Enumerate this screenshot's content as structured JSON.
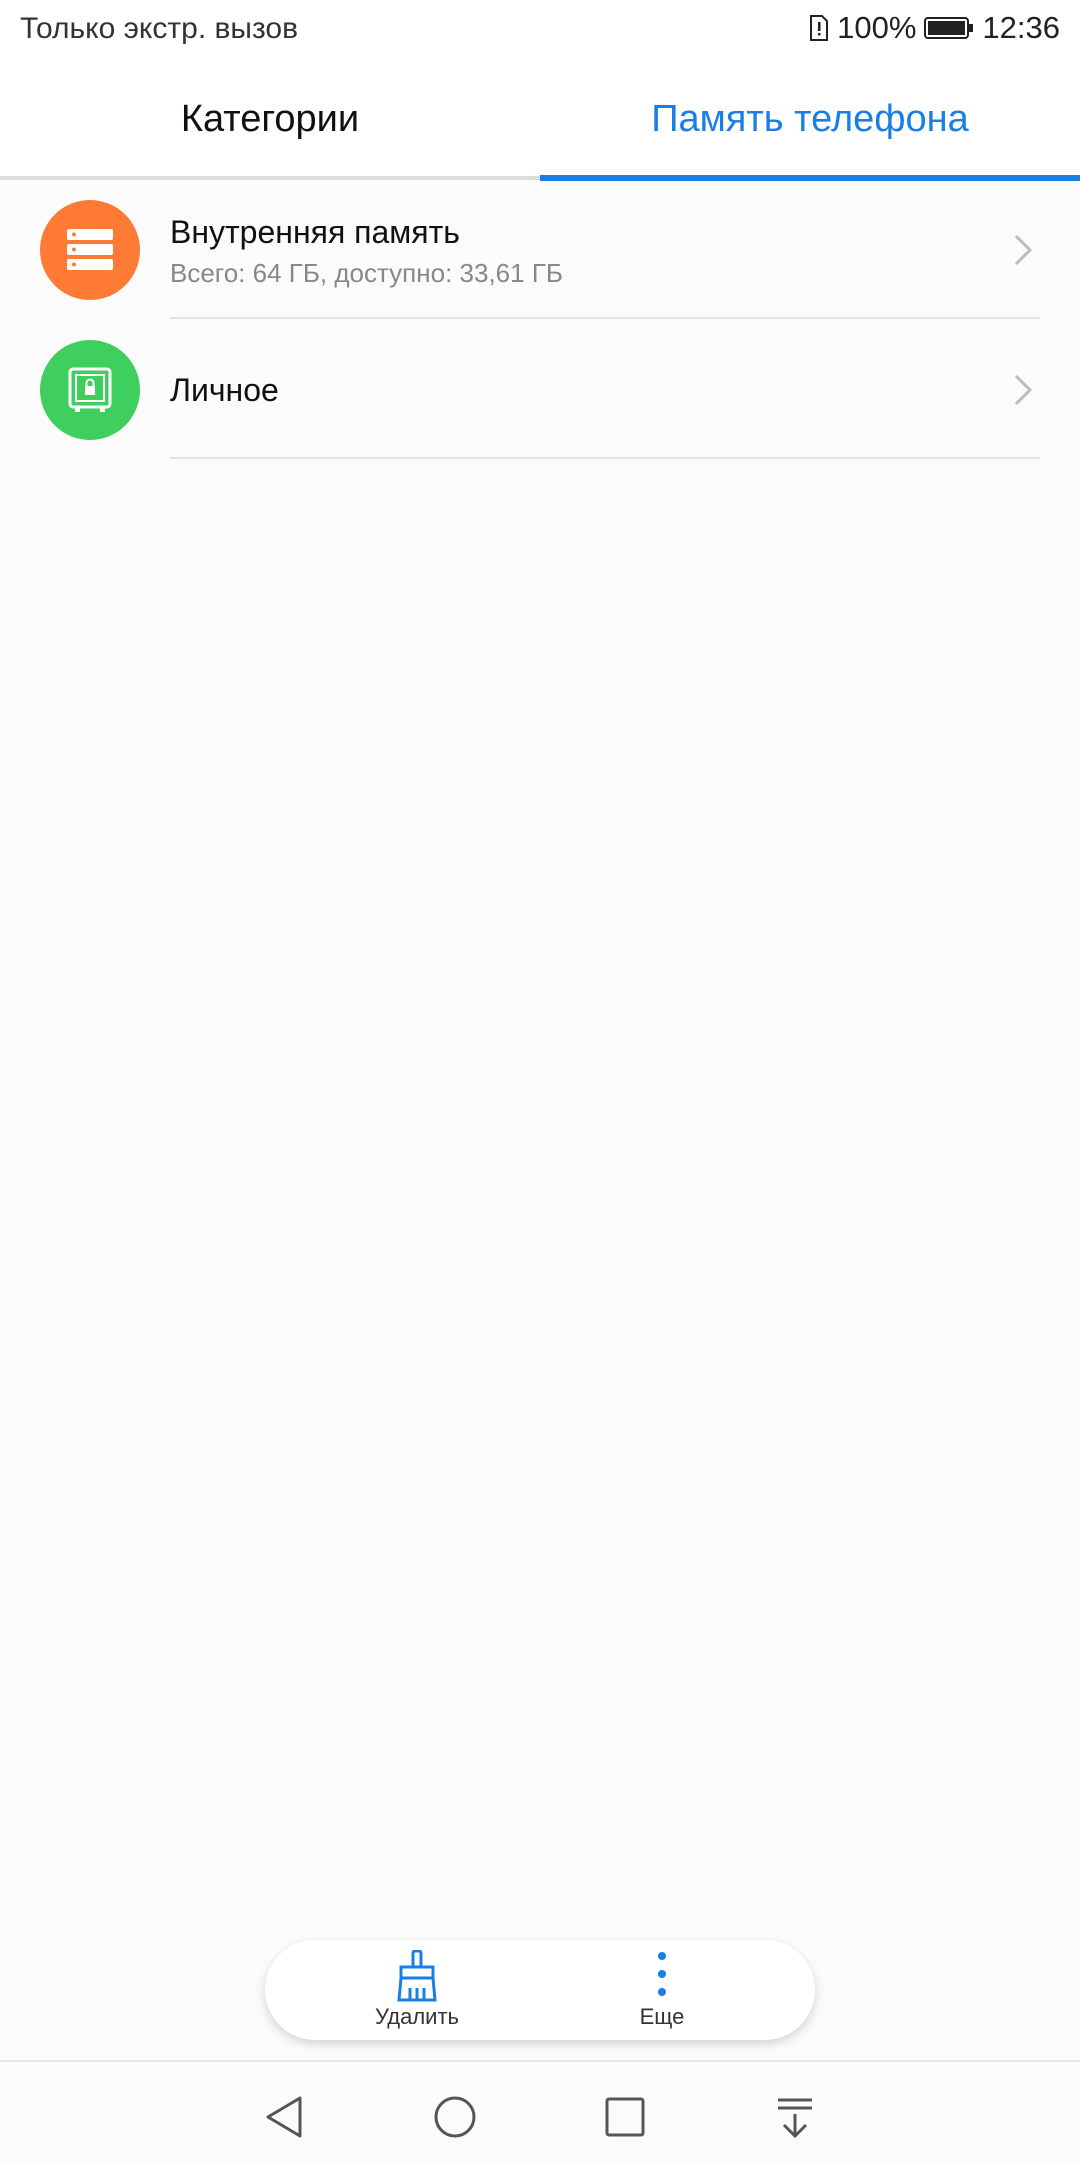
{
  "status_bar": {
    "carrier_text": "Только экстр. вызов",
    "battery_percent": "100%",
    "time": "12:36"
  },
  "tabs": [
    {
      "label": "Категории",
      "active": false
    },
    {
      "label": "Память телефона",
      "active": true
    }
  ],
  "storage_items": [
    {
      "title": "Внутренняя память",
      "subtitle": "Всего: 64 ГБ, доступно: 33,61 ГБ",
      "icon": "storage-icon",
      "color": "#ff7a35"
    },
    {
      "title": "Личное",
      "subtitle": "",
      "icon": "safe-icon",
      "color": "#3fcf5e"
    }
  ],
  "bottom_actions": [
    {
      "label": "Удалить",
      "icon": "broom-icon"
    },
    {
      "label": "Еще",
      "icon": "more-vertical-icon"
    }
  ],
  "colors": {
    "accent": "#1a7fe5",
    "background": "#fbfbfb"
  },
  "navigation": {
    "icons": [
      "back-icon",
      "home-icon",
      "recents-icon",
      "notification-pull-icon"
    ]
  }
}
